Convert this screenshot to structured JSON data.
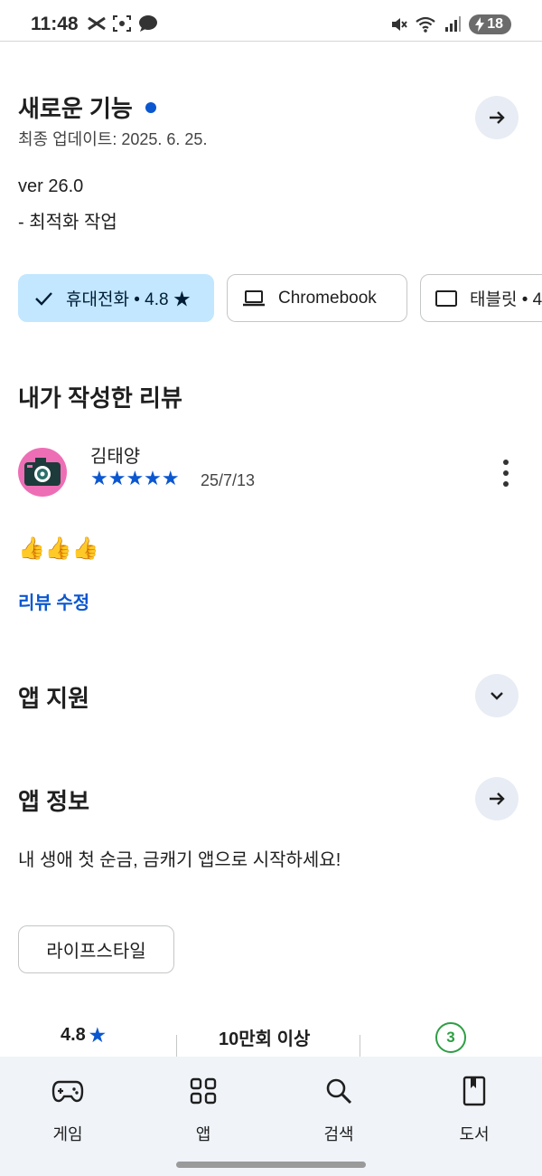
{
  "status_bar": {
    "time": "11:48",
    "battery": "18"
  },
  "whats_new": {
    "title": "새로운 기능",
    "last_updated": "최종 업데이트: 2025. 6. 25.",
    "version": "ver 26.0",
    "notes": "- 최적화 작업"
  },
  "devices": [
    {
      "label": "휴대전화 • 4.8 ★",
      "icon": "check-icon",
      "selected": true
    },
    {
      "label": "Chromebook",
      "icon": "laptop-icon",
      "selected": false
    },
    {
      "label": "태블릿 • 4",
      "icon": "tablet-icon",
      "selected": false
    }
  ],
  "my_review": {
    "title": "내가 작성한 리뷰",
    "reviewer": "김태양",
    "rating": 5,
    "stars": "★★★★★",
    "date": "25/7/13",
    "text": "👍👍👍",
    "edit_label": "리뷰 수정"
  },
  "app_support": {
    "title": "앱 지원"
  },
  "app_info": {
    "title": "앱 정보",
    "description": "내 생애 첫 순금, 금캐기 앱으로 시작하세요!",
    "category": "라이프스타일"
  },
  "stats": {
    "rating": "4.8",
    "rating_star": "★",
    "downloads": "10만회 이상",
    "age_rating": "3"
  },
  "bottom_nav": [
    {
      "label": "게임",
      "icon": "gamepad-icon"
    },
    {
      "label": "앱",
      "icon": "apps-grid-icon"
    },
    {
      "label": "검색",
      "icon": "search-icon"
    },
    {
      "label": "도서",
      "icon": "book-icon"
    }
  ],
  "colors": {
    "accent": "#0b57d0",
    "chip_selected": "#c2e7ff",
    "nav_bg": "#f0f4f9",
    "age_green": "#2e9e44"
  }
}
